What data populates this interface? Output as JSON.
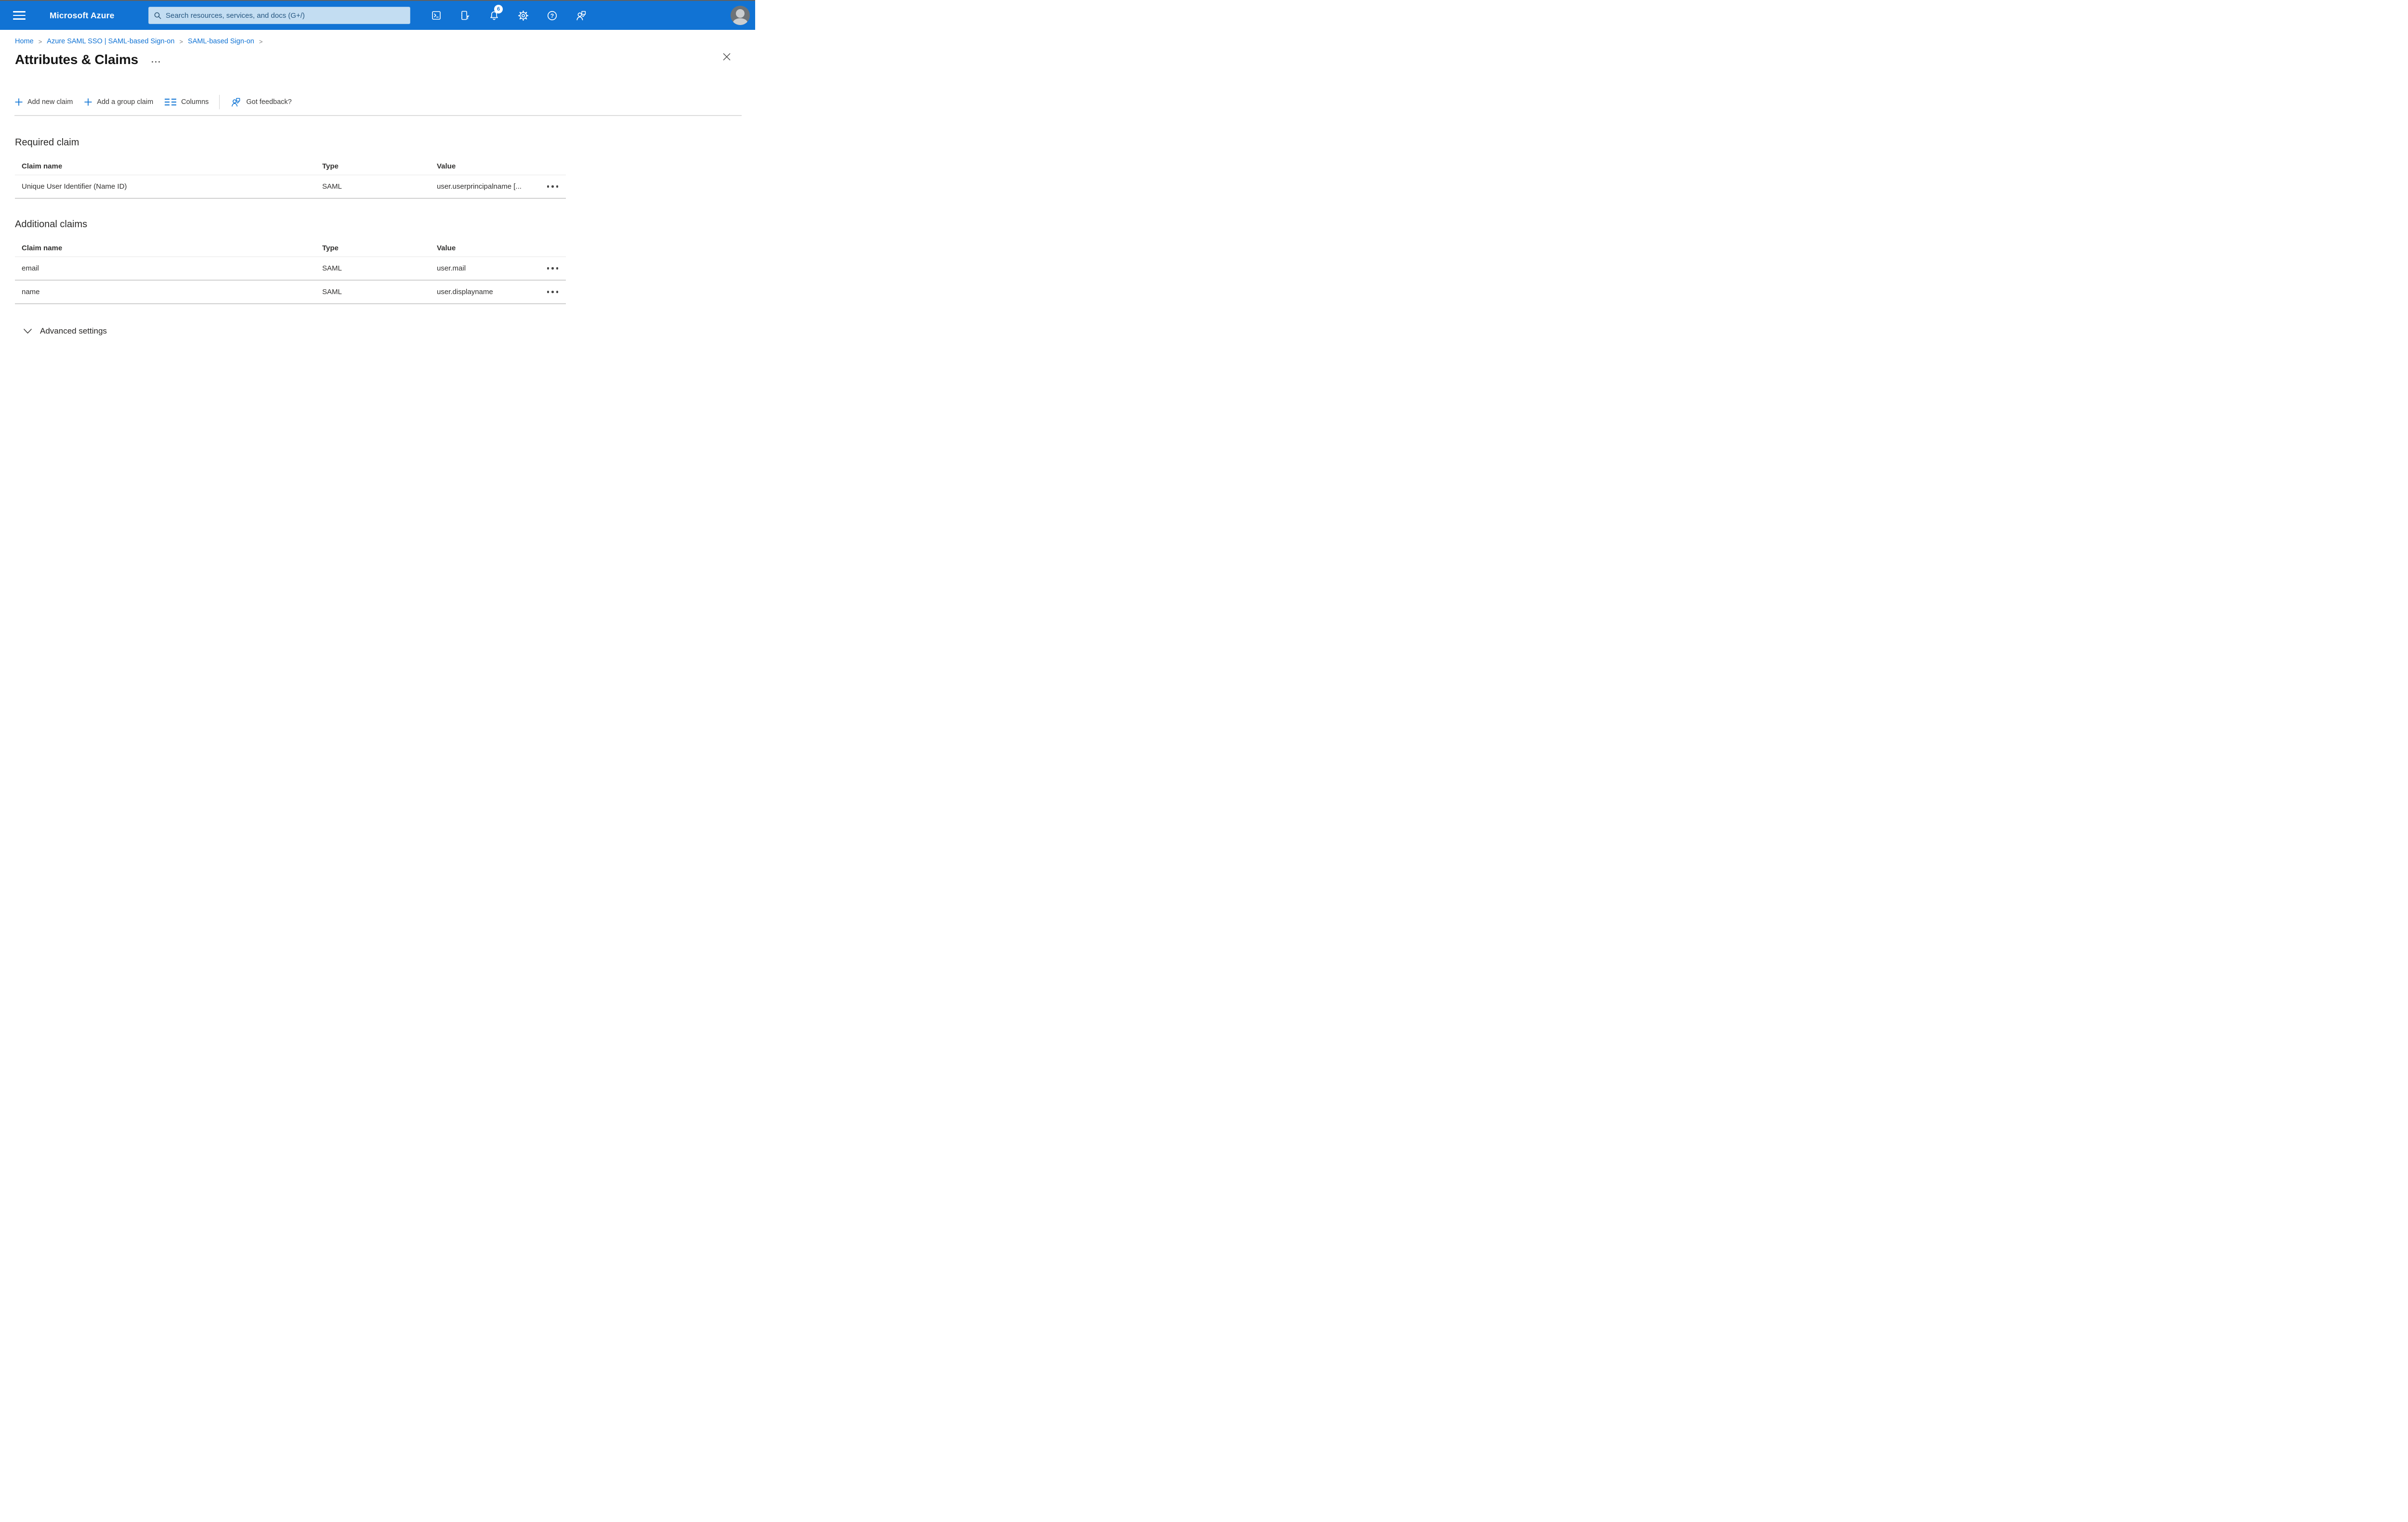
{
  "topbar": {
    "brand": "Microsoft Azure",
    "search_placeholder": "Search resources, services, and docs (G+/)",
    "notification_count": "6"
  },
  "breadcrumb": {
    "separator": ">",
    "items": [
      "Home",
      "Azure SAML SSO | SAML-based Sign-on",
      "SAML-based Sign-on"
    ]
  },
  "page": {
    "title": "Attributes & Claims"
  },
  "toolbar": {
    "add_new_claim": "Add new claim",
    "add_group_claim": "Add a group claim",
    "columns": "Columns",
    "got_feedback": "Got feedback?"
  },
  "required_claim": {
    "heading": "Required claim",
    "columns": [
      "Claim name",
      "Type",
      "Value"
    ],
    "rows": [
      {
        "claim_name": "Unique User Identifier (Name ID)",
        "type": "SAML",
        "value": "user.userprincipalname [..."
      }
    ]
  },
  "additional_claims": {
    "heading": "Additional claims",
    "columns": [
      "Claim name",
      "Type",
      "Value"
    ],
    "rows": [
      {
        "claim_name": "email",
        "type": "SAML",
        "value": "user.mail"
      },
      {
        "claim_name": "name",
        "type": "SAML",
        "value": "user.displayname"
      }
    ]
  },
  "advanced_settings_label": "Advanced settings",
  "colors": {
    "accent": "#0f74d4",
    "topbar": "#1173d4",
    "search_bg": "#c3ddf2"
  }
}
